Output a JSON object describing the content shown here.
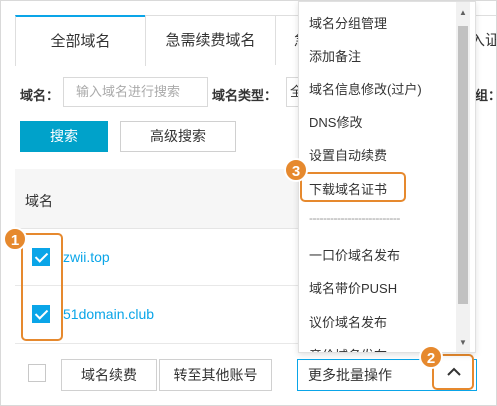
{
  "tabs": [
    {
      "label": "全部域名"
    },
    {
      "label": "急需续费域名"
    },
    {
      "label": "急"
    },
    {
      "label": "入证"
    }
  ],
  "filters": {
    "domain_label": "域名：",
    "search_placeholder": "输入域名进行搜索",
    "type_label": "域名类型：",
    "type_value": "全",
    "group_label": "组：",
    "search_button": "搜索",
    "advanced_button": "高级搜索"
  },
  "table": {
    "header_domain": "域名",
    "rows": [
      {
        "domain": "zwii.top",
        "checked": true
      },
      {
        "domain": "51domain.club",
        "checked": true
      }
    ]
  },
  "footer": {
    "renew_button": "域名续费",
    "transfer_button": "转至其他账号",
    "batch_select": "更多批量操作"
  },
  "menu": {
    "items": [
      "域名分组管理",
      "添加备注",
      "域名信息修改(过户)",
      "DNS修改",
      "设置自动续费",
      "下载域名证书",
      "一口价域名发布",
      "域名带价PUSH",
      "议价域名发布",
      "竞价域名发布"
    ],
    "divider": "--------------------------"
  },
  "badges": {
    "one": "1",
    "two": "2",
    "three": "3"
  },
  "colors": {
    "accent": "#0aa5e8",
    "primary_button": "#00a2ca",
    "callout": "#e6892e"
  }
}
